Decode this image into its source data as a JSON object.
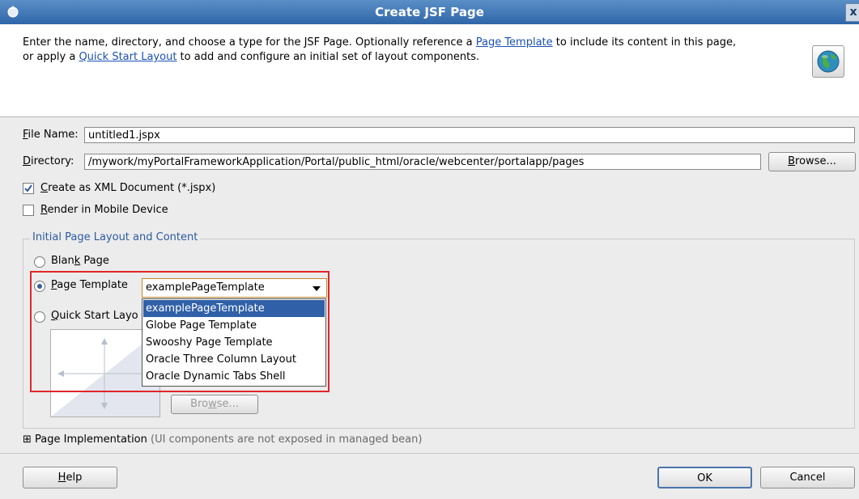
{
  "window": {
    "title": "Create JSF Page",
    "close_label": "x"
  },
  "header": {
    "desc_part1": "Enter the name, directory, and choose a type for the JSF Page. Optionally reference a ",
    "link_page_template": "Page Template",
    "desc_part2": " to include its content in this page,",
    "desc_part3": "or apply a ",
    "link_quick_start": "Quick Start Layout",
    "desc_part4": " to add and configure an initial set of layout components."
  },
  "form": {
    "file_name_label_u": "F",
    "file_name_label_rest": "ile Name:",
    "file_name_value": "untitled1.jspx",
    "directory_label_u": "D",
    "directory_label_rest": "irectory:",
    "directory_value": "/mywork/myPortalFrameworkApplication/Portal/public_html/oracle/webcenter/portalapp/pages",
    "browse_u": "B",
    "browse_rest": "rowse...",
    "create_xml_u": "C",
    "create_xml_rest": "reate as XML Document (*.jspx)",
    "create_xml_checked": true,
    "render_mobile_u": "R",
    "render_mobile_rest": "ender in Mobile Device",
    "render_mobile_checked": false
  },
  "layout_group": {
    "title": "Initial Page Layout and Content",
    "blank_page_pre": "Blan",
    "blank_page_u": "k",
    "blank_page_post": " Page",
    "page_template_u": "P",
    "page_template_rest": "age Template",
    "page_template_selected": "examplePageTemplate",
    "quick_start_u": "Q",
    "quick_start_rest": "uick Start Layo",
    "dropdown_options": [
      "examplePageTemplate",
      "Globe Page Template",
      "Swooshy Page Template",
      "Oracle Three Column Layout",
      "Oracle Dynamic Tabs Shell"
    ],
    "browse_pre": "Bro",
    "browse_u": "w",
    "browse_post": "se..."
  },
  "implementation": {
    "expand_symbol": "⊞",
    "label": "Page Implementation",
    "note": " (UI components are not exposed in managed bean)"
  },
  "footer": {
    "help_u": "H",
    "help_rest": "elp",
    "ok_label": "OK",
    "cancel_label": "Cancel"
  },
  "colors": {
    "titlebar": "#3f77b8",
    "selection": "#2f60a8",
    "highlight_box": "#e0262b",
    "link": "#1a50b8"
  }
}
